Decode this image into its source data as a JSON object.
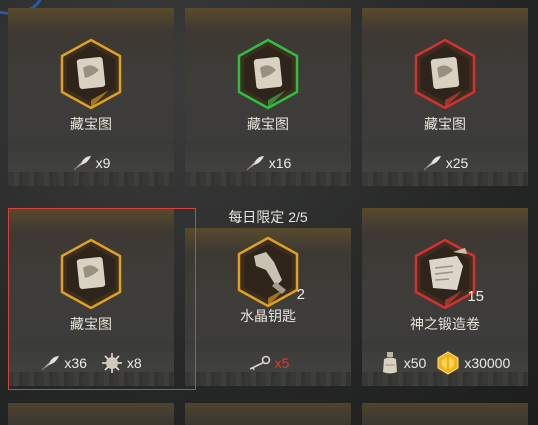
{
  "shop": {
    "daily_limit": "每日限定 2/5",
    "items": [
      {
        "name": "藏宝图",
        "frame": "#e0a020",
        "prices": [
          {
            "icon": "feather-icon",
            "amount": "x9"
          }
        ]
      },
      {
        "name": "藏宝图",
        "frame": "#2fbf3f",
        "prices": [
          {
            "icon": "feather-icon",
            "amount": "x16"
          }
        ]
      },
      {
        "name": "藏宝图",
        "frame": "#d83030",
        "prices": [
          {
            "icon": "feather-icon",
            "amount": "x25"
          }
        ]
      },
      {
        "name": "藏宝图",
        "frame": "#e0a020",
        "prices": [
          {
            "icon": "feather-icon",
            "amount": "x36"
          },
          {
            "icon": "spiky-shell-icon",
            "amount": "x8"
          }
        ]
      },
      {
        "name": "水晶钥匙",
        "quantity": "2",
        "frame": "#e0a020",
        "prices": [
          {
            "icon": "key-icon",
            "amount": "x5"
          }
        ]
      },
      {
        "name": "神之锻造卷",
        "quantity": "15",
        "frame": "#d83030",
        "prices": [
          {
            "icon": "bottle-icon",
            "amount": "x50"
          },
          {
            "icon": "gold-crystal-icon",
            "amount": "x30000"
          }
        ]
      }
    ]
  }
}
